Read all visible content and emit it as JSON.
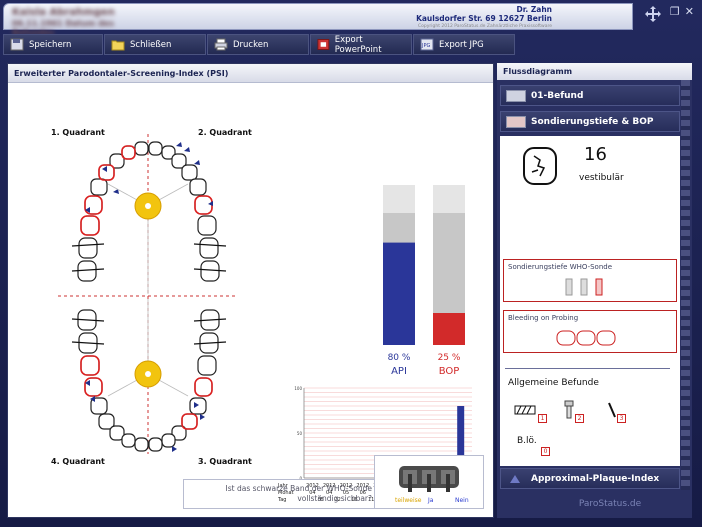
{
  "header": {
    "patient_name": "Kaisla Abrahmgen",
    "patient_details": "06.11.1961   Datum des Befundes",
    "practice_name": "Dr. Zahn",
    "practice_address": "Kaulsdorfer Str. 69 12627 Berlin",
    "copyright": "Copyright 2012 ParoStatus.de Zahnärztliche Praxissoftware"
  },
  "toolbar": {
    "save": "Speichern",
    "close": "Schließen",
    "print": "Drucken",
    "export_ppt": "Export PowerPoint",
    "export_jpg": "Export JPG"
  },
  "left": {
    "title": "Erweiterter Parodontaler-Screening-Index (PSI)",
    "q1": "1. Quadrant",
    "q2": "2. Quadrant",
    "q3": "3. Quadrant",
    "q4": "4. Quadrant",
    "api_value": "80 %",
    "api_label": "API",
    "bop_value": "25 %",
    "bop_label": "BOP",
    "question": "Ist das schwarze Band der WHO-Sonde vollständig sichbar?",
    "sonde_teilweise": "teilweise",
    "sonde_ja": "Ja",
    "sonde_nein": "Nein"
  },
  "chart_data": {
    "type": "bar",
    "row_labels": [
      "Jahr",
      "Monat",
      "Tag"
    ],
    "years": [
      "2012",
      "2012",
      "2012",
      "2012",
      "2012",
      "2012",
      "2012",
      "2012",
      "2012",
      "2012"
    ],
    "months": [
      "04",
      "04",
      "05",
      "06",
      "06",
      "06",
      "06",
      "06",
      "07",
      "07"
    ],
    "days": [
      "05",
      "22",
      "16",
      "11",
      "21",
      "27",
      "28",
      "03",
      "28"
    ],
    "y_ticks": [
      "100",
      "50",
      "0"
    ],
    "ylim": [
      0,
      100
    ],
    "series": [
      {
        "name": "API",
        "color": "#2a3699",
        "values": [
          0,
          0,
          0,
          0,
          0,
          0,
          0,
          0,
          0,
          80
        ]
      },
      {
        "name": "BOP",
        "color": "#d22a2a",
        "values": [
          0,
          0,
          0,
          0,
          0,
          0,
          0,
          0,
          0,
          25
        ]
      }
    ],
    "api_percent": 80,
    "bop_percent": 25
  },
  "right": {
    "title": "Flussdiagramm",
    "item1": "01-Befund",
    "item2": "Sondierungstiefe & BOP",
    "probe_value": "16",
    "probe_side": "vestibulär",
    "who_probe": "Sondierungstiefe WHO-Sonde",
    "bleeding": "Bleeding on Probing",
    "general": "Allgemeine Befunde",
    "num1": "1",
    "num2": "2",
    "num3": "3",
    "blo": "B.lö.",
    "num0": "0",
    "item3": "Approximal-Plaque-Index"
  },
  "footer": {
    "brand": "ParoStatus.de"
  },
  "colors": {
    "accent": "#2a3699",
    "bop": "#d22a2a",
    "frame": "#1a1f4a"
  }
}
